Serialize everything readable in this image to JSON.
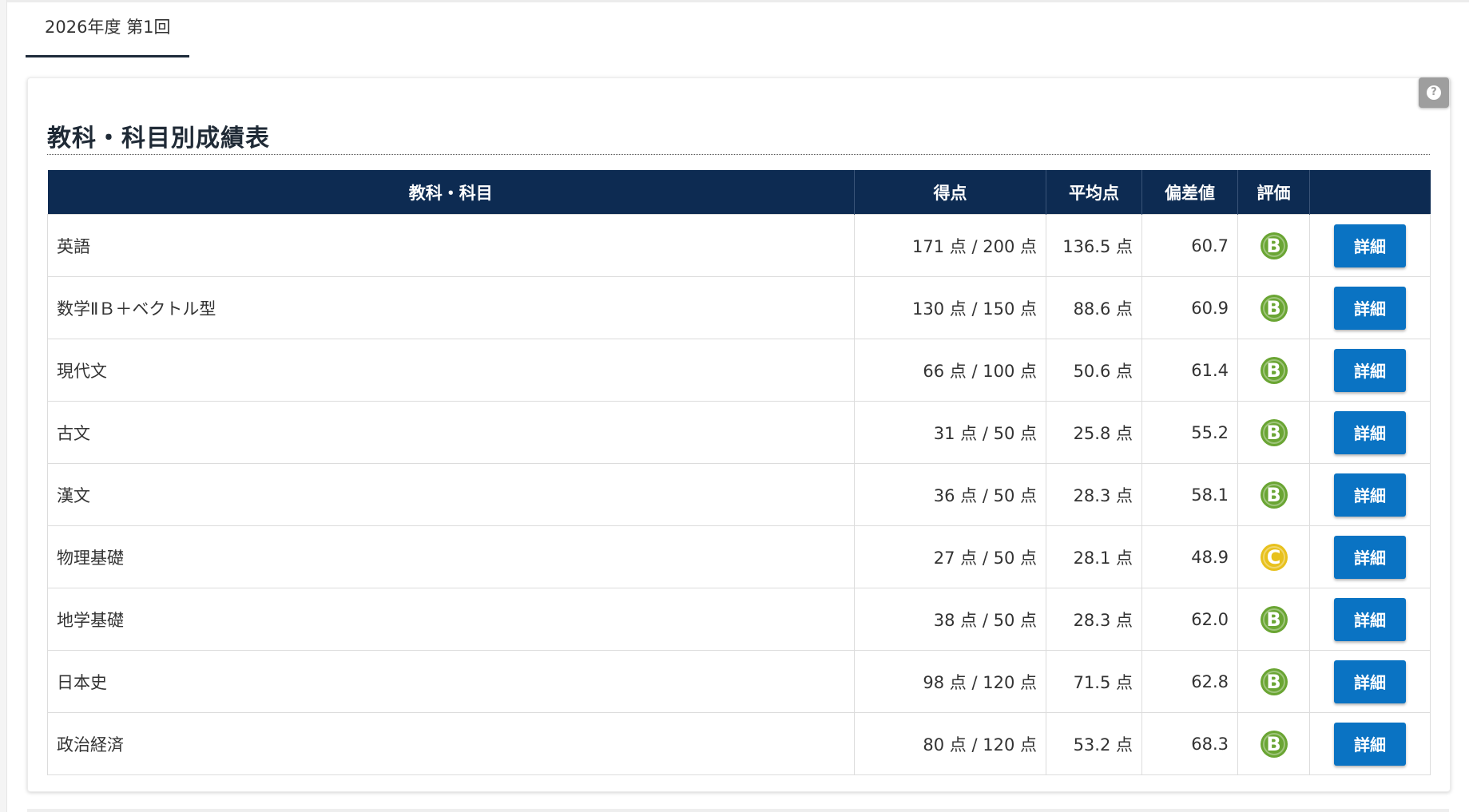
{
  "tabs": [
    {
      "label": "2026年度 第1回",
      "active": true
    }
  ],
  "section": {
    "title": "教科・科目別成績表",
    "help_icon": "?"
  },
  "table": {
    "headers": [
      "教科・科目",
      "得点",
      "平均点",
      "偏差値",
      "評価",
      ""
    ],
    "detail_label": "詳細",
    "rows": [
      {
        "subject": "英語",
        "score": "171 点 / 200 点",
        "average": "136.5 点",
        "deviation": "60.7",
        "grade": "B"
      },
      {
        "subject": "数学ⅡＢ＋ベクトル型",
        "score": "130 点 / 150 点",
        "average": "88.6 点",
        "deviation": "60.9",
        "grade": "B"
      },
      {
        "subject": "現代文",
        "score": "66 点 / 100 点",
        "average": "50.6 点",
        "deviation": "61.4",
        "grade": "B"
      },
      {
        "subject": "古文",
        "score": "31 点 / 50 点",
        "average": "25.8 点",
        "deviation": "55.2",
        "grade": "B"
      },
      {
        "subject": "漢文",
        "score": "36 点 / 50 点",
        "average": "28.3 点",
        "deviation": "58.1",
        "grade": "B"
      },
      {
        "subject": "物理基礎",
        "score": "27 点 / 50 点",
        "average": "28.1 点",
        "deviation": "48.9",
        "grade": "C"
      },
      {
        "subject": "地学基礎",
        "score": "38 点 / 50 点",
        "average": "28.3 点",
        "deviation": "62.0",
        "grade": "B"
      },
      {
        "subject": "日本史",
        "score": "98 点 / 120 点",
        "average": "71.5 点",
        "deviation": "62.8",
        "grade": "B"
      },
      {
        "subject": "政治経済",
        "score": "80 点 / 120 点",
        "average": "53.2 点",
        "deviation": "68.3",
        "grade": "B"
      }
    ]
  },
  "colors": {
    "header_bg": "#0d2b52",
    "detail_button": "#0a73c3",
    "grade_B": "#6aa533",
    "grade_C": "#e8c11d"
  }
}
